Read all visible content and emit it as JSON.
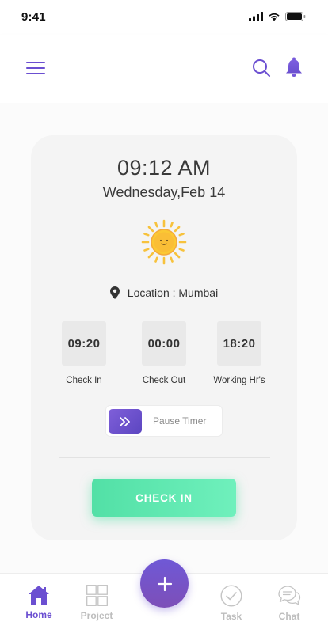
{
  "status_bar": {
    "time": "9:41"
  },
  "card": {
    "time": "09:12 AM",
    "date": "Wednesday,Feb 14",
    "location": "Location : Mumbai",
    "stats": [
      {
        "value": "09:20",
        "label": "Check In"
      },
      {
        "value": "00:00",
        "label": "Check Out"
      },
      {
        "value": "18:20",
        "label": "Working Hr's"
      }
    ],
    "pause_label": "Pause Timer",
    "checkin_label": "CHECK IN"
  },
  "tabs": [
    {
      "label": "Home",
      "icon": "home-icon",
      "active": true
    },
    {
      "label": "Project",
      "icon": "grid-icon",
      "active": false
    },
    {
      "label": "Task",
      "icon": "check-circle-icon",
      "active": false
    },
    {
      "label": "Chat",
      "icon": "chat-bubbles-icon",
      "active": false
    }
  ],
  "colors": {
    "accent": "#6b4fd1",
    "checkin_green": "#5de6ae",
    "inactive_tab": "#bdbdbd"
  }
}
